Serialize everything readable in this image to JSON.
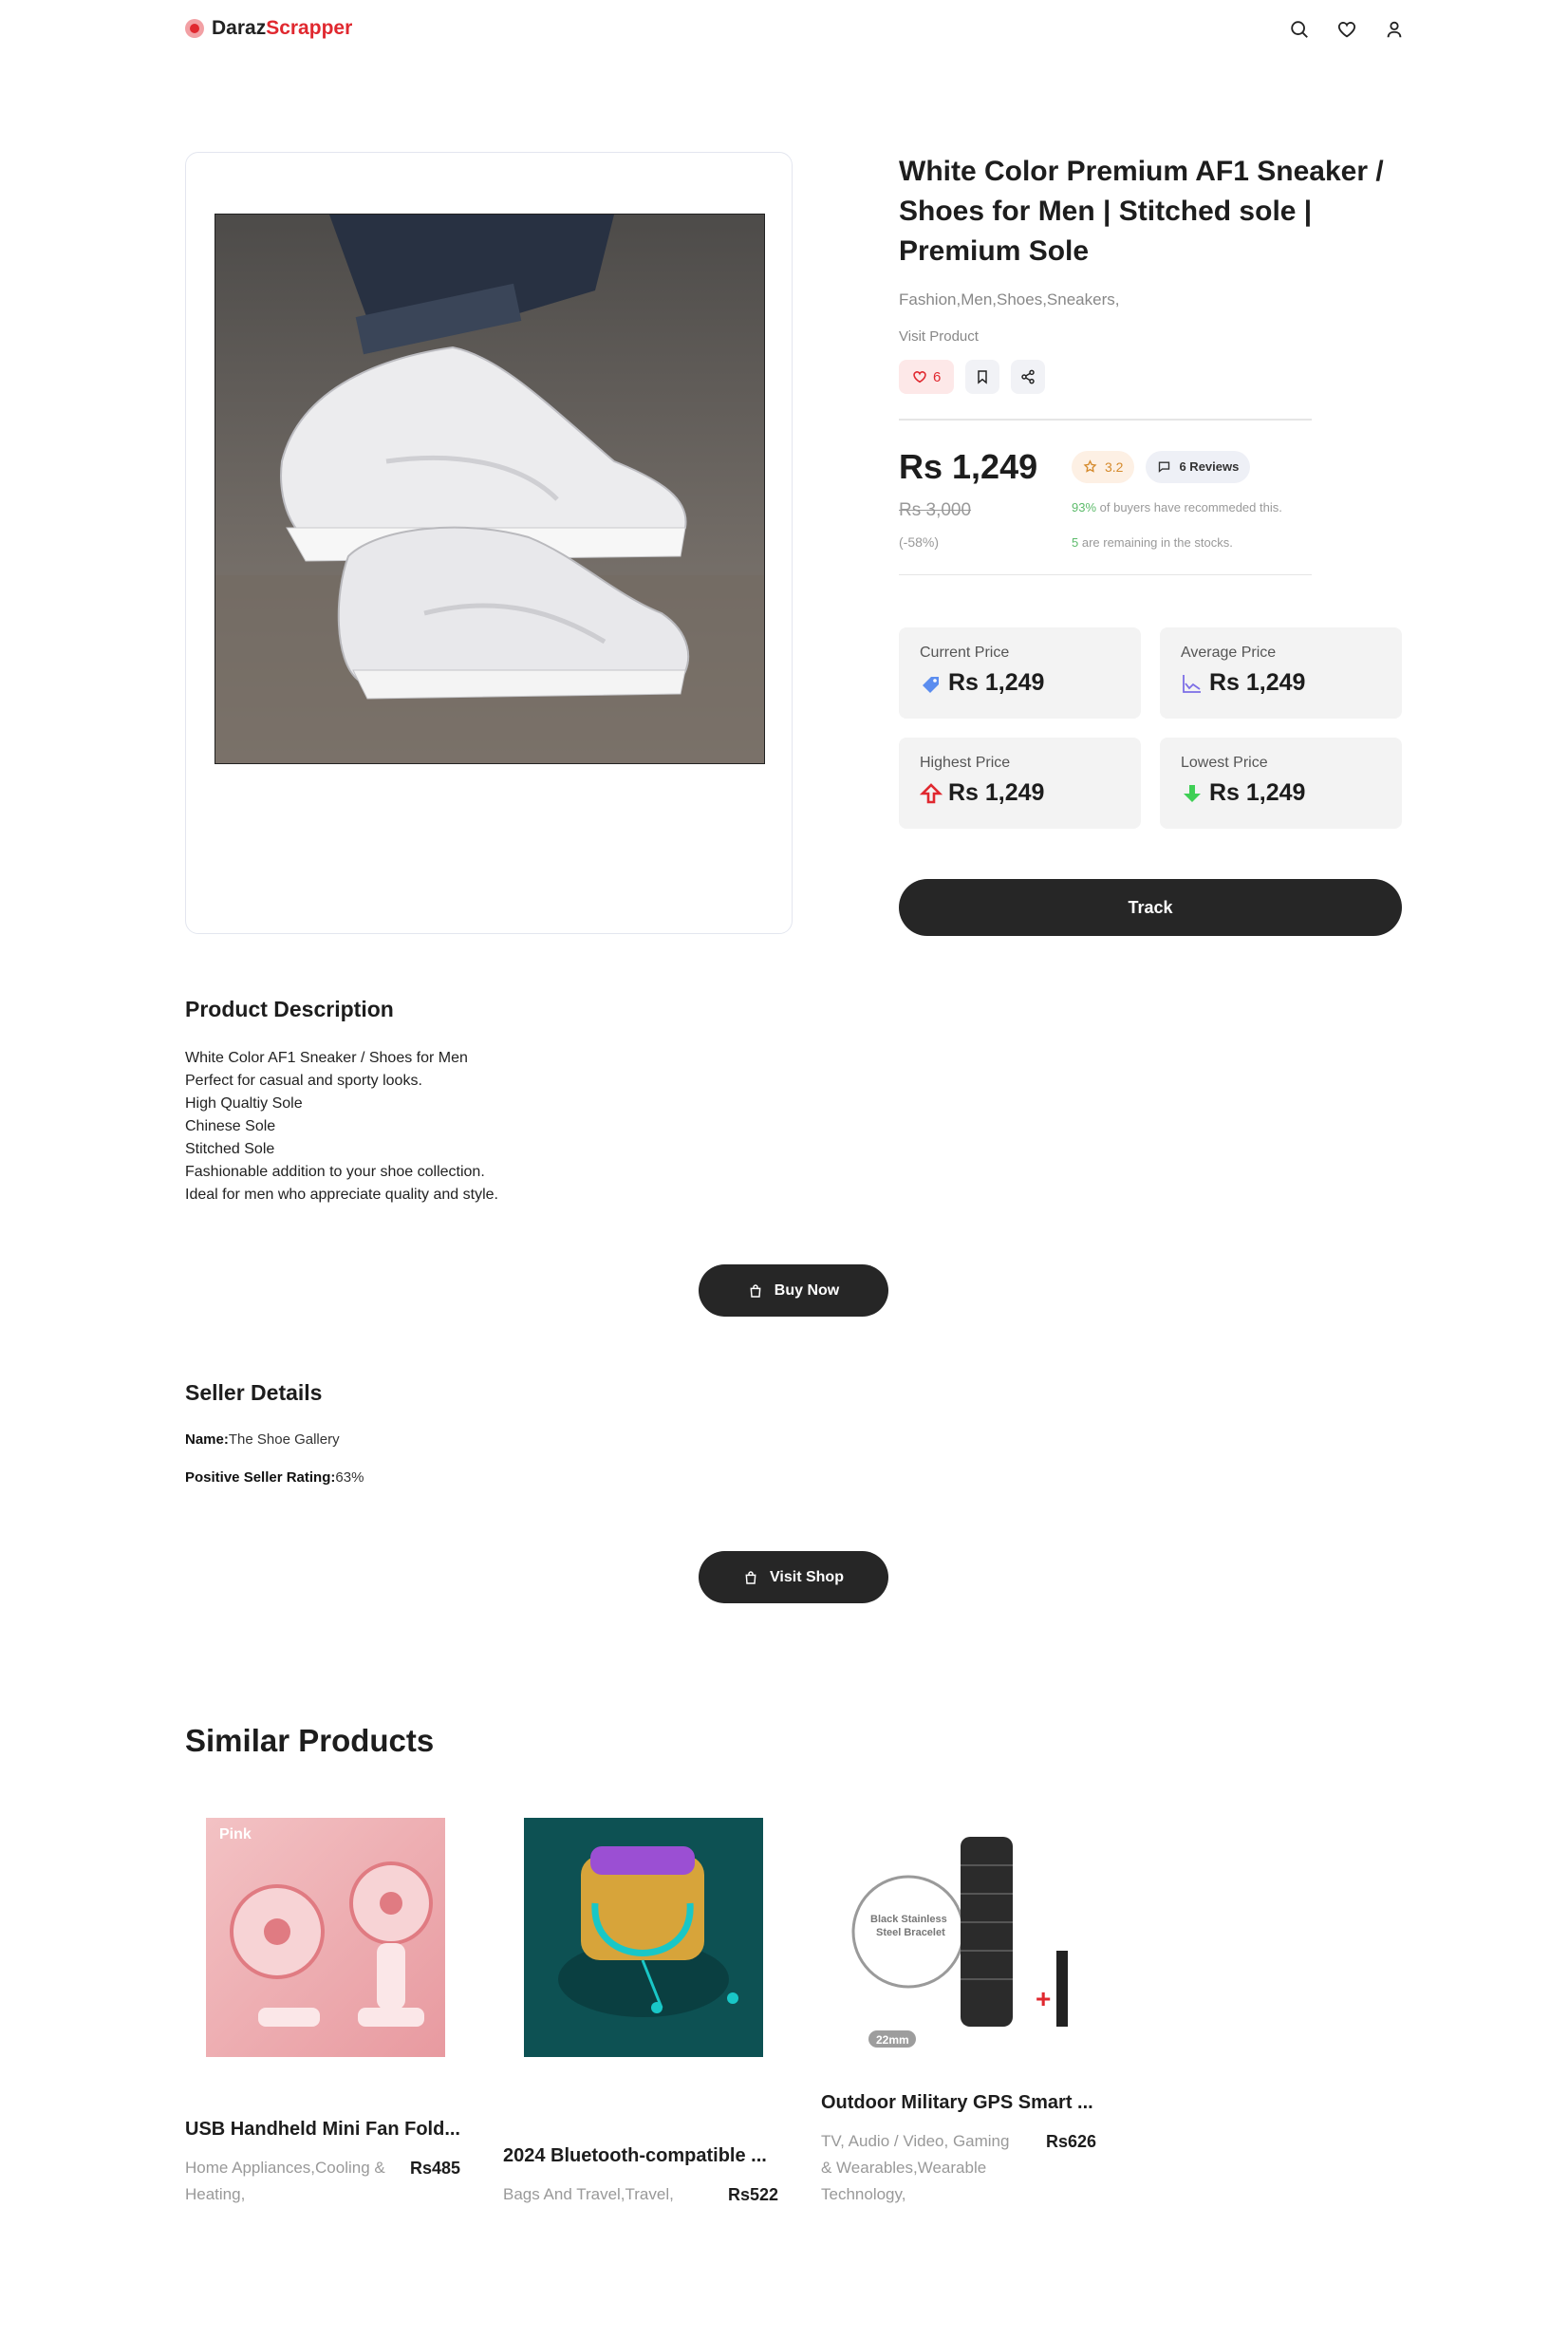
{
  "header": {
    "brand_part1": "Daraz",
    "brand_part2": "Scrapper",
    "icons": [
      "search-icon",
      "heart-icon",
      "user-icon"
    ]
  },
  "product": {
    "title": "White Color Premium AF1 Sneaker / Shoes for Men | Stitched sole | Premium Sole",
    "categories": "Fashion,Men,Shoes,Sneakers,",
    "visit_label": "Visit Product",
    "likes": "6",
    "current_price": "Rs 1,249",
    "old_price": "Rs 3,000",
    "discount": "(-58%)",
    "rating": "3.2",
    "reviews": "6 Reviews",
    "recommend_pct": "93%",
    "recommend_text": " of buyers have recommeded this.",
    "stock_count": "5",
    "stock_text": " are remaining in the stocks."
  },
  "stats": {
    "current_label": "Current Price",
    "current_value": "Rs 1,249",
    "average_label": "Average Price",
    "average_value": "Rs 1,249",
    "highest_label": "Highest Price",
    "highest_value": "Rs 1,249",
    "lowest_label": "Lowest Price",
    "lowest_value": "Rs 1,249"
  },
  "track_label": "Track",
  "description": {
    "heading": "Product Description",
    "lines": [
      "White Color AF1 Sneaker / Shoes for Men",
      "Perfect for casual and sporty looks.",
      "High Qualtiy Sole",
      "Chinese Sole",
      "Stitched Sole",
      "Fashionable addition to your shoe collection.",
      "Ideal for men who appreciate quality and style."
    ]
  },
  "buy_now_label": "Buy Now",
  "seller": {
    "heading": "Seller Details",
    "name_label": "Name:",
    "name_value": "The Shoe Gallery",
    "rating_label": "Positive Seller Rating:",
    "rating_value": "63%"
  },
  "visit_shop_label": "Visit Shop",
  "similar": {
    "heading": "Similar Products",
    "items": [
      {
        "name": "USB Handheld Mini Fan Fold...",
        "category_line1": "Home Appliances,Cooling &",
        "category_line2": "Heating,",
        "price": "Rs485"
      },
      {
        "name": "2024 Bluetooth-compatible ...",
        "category_line1": "Bags And Travel,Travel,",
        "price": "Rs522"
      },
      {
        "name": "Outdoor Military GPS Smart ...",
        "category_line1": "TV, Audio / Video, Gaming",
        "category_line2": "& Wearables,Wearable",
        "category_line3": "Technology,",
        "price": "Rs626",
        "image_badge": "22mm",
        "image_text": "Black Stainless Steel Bracelet"
      }
    ],
    "fan_image_text": "Pink"
  },
  "colors": {
    "accent_red": "#e0282f",
    "dark_button": "#262626",
    "green": "#5dbb6b"
  }
}
